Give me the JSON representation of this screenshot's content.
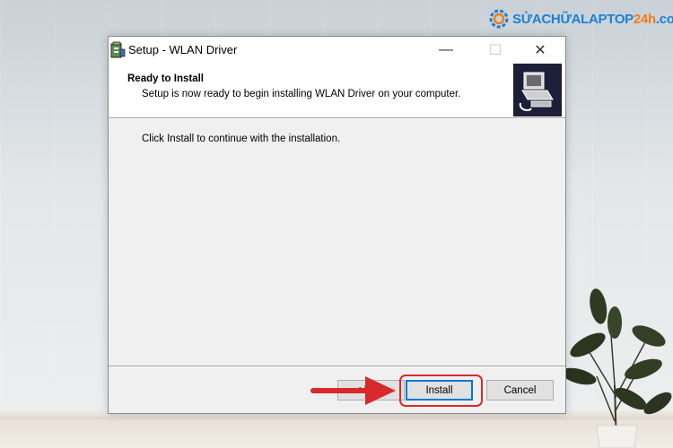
{
  "logo": {
    "text_main": "SỬACHỮALAPTOP",
    "text_accent": "24h",
    "text_tld": ".com",
    "icon": "gear-icon"
  },
  "window": {
    "title": "Setup - WLAN Driver",
    "app_icon": "setup-installer-icon",
    "controls": {
      "minimize": "—",
      "maximize": "☐",
      "close": "✕"
    }
  },
  "header": {
    "title": "Ready to Install",
    "subtitle": "Setup is now ready to begin installing WLAN Driver on your computer.",
    "image_icon": "computer-install-icon"
  },
  "body": {
    "message": "Click Install to continue with the installation."
  },
  "buttons": {
    "back": "< Back",
    "install": "Install",
    "cancel": "Cancel"
  },
  "annotation": {
    "color": "#d8292b",
    "arrow_icon": "red-arrow-icon"
  }
}
